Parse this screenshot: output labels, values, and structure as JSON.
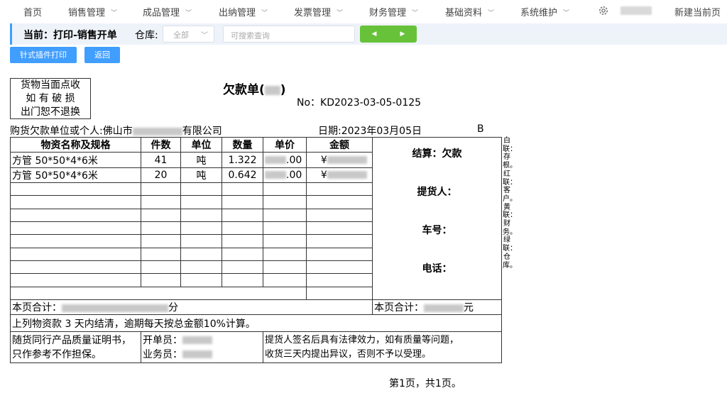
{
  "nav": {
    "home": "首页",
    "sales": "销售管理",
    "products": "成品管理",
    "cashier": "出纳管理",
    "invoice": "发票管理",
    "finance": "财务管理",
    "basic": "基础资料",
    "system": "系统维护",
    "new_page": "新建当前页",
    "settings_icon": "gear-icon"
  },
  "subbar": {
    "title": "当前：打印-销售开单",
    "warehouse_label": "仓库:",
    "warehouse_value": "全部",
    "search_placeholder": "可搜索查询",
    "prev_icon": "caret-left-icon",
    "next_icon": "caret-right-icon"
  },
  "buttons": {
    "dot_print": "针式插件打印",
    "back": "返回"
  },
  "colors": {
    "primary": "#409eff",
    "success": "#67c23a",
    "subbar_bg": "#eef3fa"
  },
  "doc": {
    "stamp_line1": "货物当面点收",
    "stamp_line2": "如 有 破 损",
    "stamp_line3": "出门恕不退换",
    "title_prefix": "欠款单(",
    "title_suffix": ")",
    "no": "No：KD2023-03-05-0125",
    "buyer_prefix": "购货欠款单位或个人:佛山市",
    "buyer_suffix": "有限公司",
    "date": "日期:2023年03月05日",
    "copy_mark": "B",
    "headers": [
      "物资名称及规格",
      "件数",
      "单位",
      "数量",
      "单价",
      "金额"
    ],
    "rows": [
      {
        "name": "方管 50*50*4*6米",
        "count": "41",
        "unit": "吨",
        "qty": "1.322",
        "price_suffix": ".00",
        "amount_prefix": "¥"
      },
      {
        "name": "方管 50*50*4*6米",
        "count": "20",
        "unit": "吨",
        "qty": "0.642",
        "price_suffix": ".00",
        "amount_prefix": "¥"
      }
    ],
    "side": {
      "settle": "结算：欠款",
      "picker": "提货人：",
      "plate": "车号：",
      "phone": "电话："
    },
    "page_total_label": "本页合计：",
    "page_total_unit": "分",
    "page_total_label2": "本页合计：",
    "page_total_unit2": "元",
    "terms": "上列物资款 3 天内结清，逾期每天按总金额10%计算。",
    "cert_line1": "随货同行产品质量证明书，",
    "cert_line2": "只作参考不作担保。",
    "issuer_label": "开单员：",
    "sales_label": "业务员：",
    "legal_line1": "提货人签名后具有法律效力，如有质量等问题，",
    "legal_line2": "收货三天内提出异议，否则不予以受理。",
    "vertical_note": "白联：存根。红联：客户。黄联：财务。绿联：仓库。",
    "page_foot": "第1页，共1页。"
  }
}
